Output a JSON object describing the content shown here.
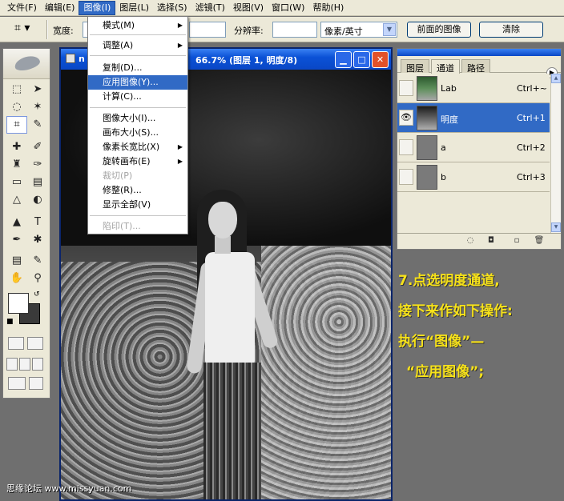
{
  "menubar": {
    "items": [
      "文件(F)",
      "编辑(E)",
      "图像(I)",
      "图层(L)",
      "选择(S)",
      "滤镜(T)",
      "视图(V)",
      "窗口(W)",
      "帮助(H)"
    ]
  },
  "options": {
    "width_label": "宽度:",
    "resolution_label": "分辨率:",
    "unit_value": "像素/英寸",
    "front_image_button": "前面的图像",
    "clear_button": "清除"
  },
  "document": {
    "title_left": "n",
    "title_right": "66.7% (图层 1, 明度/8)"
  },
  "image_menu": {
    "items": [
      {
        "label": "模式(M)",
        "sub": true
      },
      {
        "label": "调整(A)",
        "sub": true
      },
      {
        "label": "复制(D)..."
      },
      {
        "label": "应用图像(Y)...",
        "highlight": true
      },
      {
        "label": "计算(C)..."
      },
      {
        "label": "图像大小(I)..."
      },
      {
        "label": "画布大小(S)..."
      },
      {
        "label": "像素长宽比(X)",
        "sub": true
      },
      {
        "label": "旋转画布(E)",
        "sub": true
      },
      {
        "label": "裁切(P)",
        "disabled": true
      },
      {
        "label": "修整(R)..."
      },
      {
        "label": "显示全部(V)"
      },
      {
        "label": "陷印(T)...",
        "disabled": true
      }
    ]
  },
  "channels_panel": {
    "tabs": [
      "图层",
      "通道",
      "路径"
    ],
    "active_tab": "通道",
    "channels": [
      {
        "name": "Lab",
        "shortcut": "Ctrl+~",
        "visible": false
      },
      {
        "name": "明度",
        "shortcut": "Ctrl+1",
        "visible": true,
        "selected": true
      },
      {
        "name": "a",
        "shortcut": "Ctrl+2",
        "visible": false
      },
      {
        "name": "b",
        "shortcut": "Ctrl+3",
        "visible": false
      }
    ]
  },
  "note": {
    "lines": [
      "7.点选明度通道,",
      "接下来作如下操作:",
      "执行“图像”—",
      "“应用图像”;"
    ],
    "color": "#f7e21a"
  },
  "watermark": "思缘论坛 www.missyuan.com"
}
